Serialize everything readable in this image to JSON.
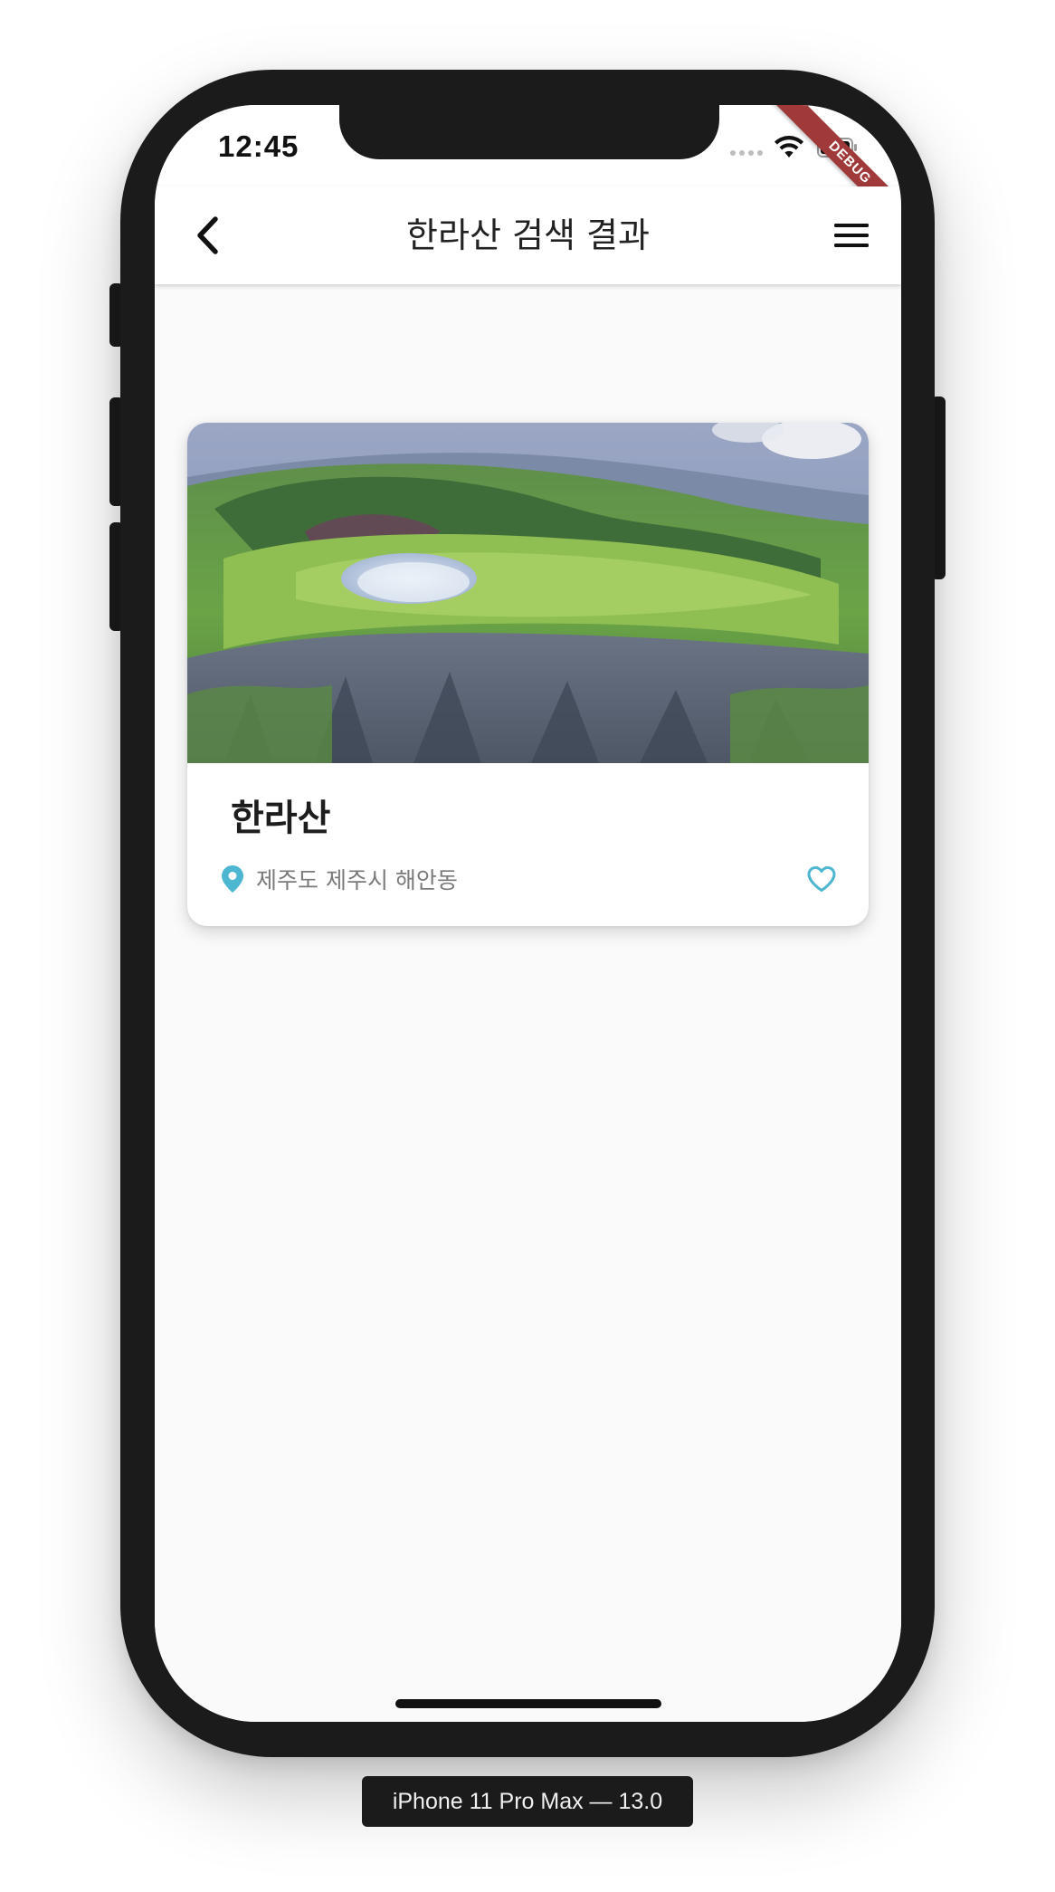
{
  "status_bar": {
    "time": "12:45",
    "icons": [
      "signal-dots-icon",
      "wifi-icon",
      "battery-icon"
    ]
  },
  "debug_banner": "DEBUG",
  "app_bar": {
    "back_icon": "chevron-left-icon",
    "title": "한라산 검색 결과",
    "menu_icon": "hamburger-menu-icon"
  },
  "results": [
    {
      "image": "hallasan-crater-photo",
      "title": "한라산",
      "location_icon": "map-pin-icon",
      "location": "제주도 제주시 해안동",
      "favorite_icon": "heart-outline-icon",
      "favorited": false
    }
  ],
  "device_label": "iPhone 11 Pro Max — 13.0",
  "colors": {
    "accent": "#4db6d0",
    "background": "#fafafa",
    "app_bar": "#ffffff",
    "title_text": "#222222",
    "secondary_text": "#7a7a7a",
    "debug_ribbon": "#a03a3a",
    "device_frame": "#1b1b1b"
  }
}
